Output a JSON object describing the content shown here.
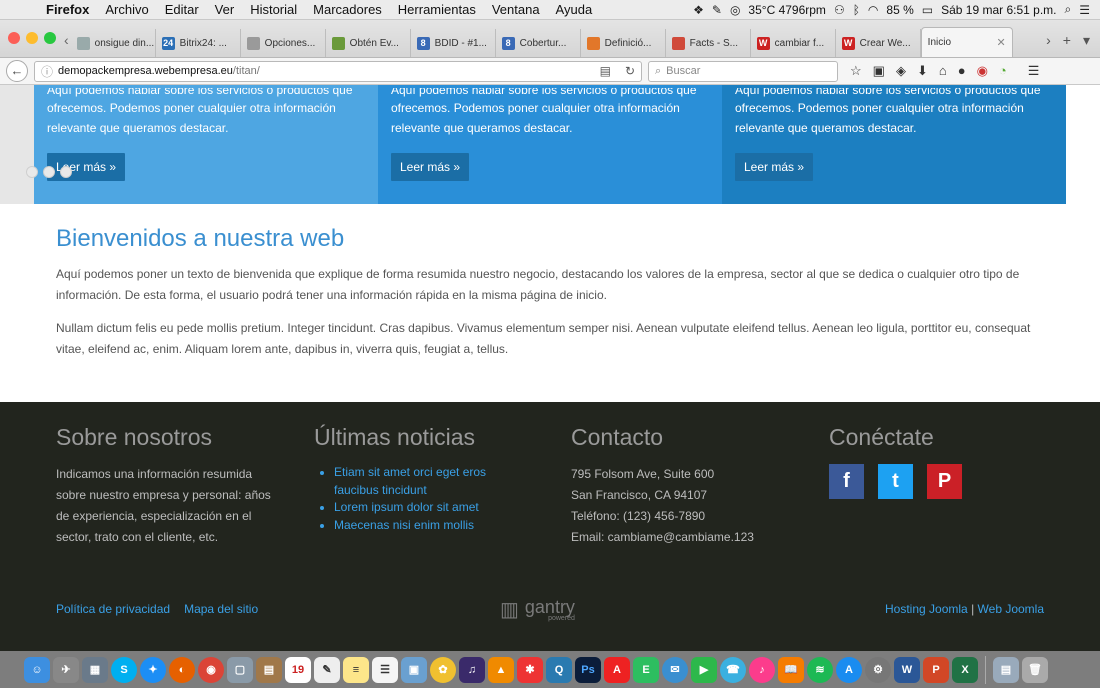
{
  "menubar": {
    "app": "Firefox",
    "items": [
      "Archivo",
      "Editar",
      "Ver",
      "Historial",
      "Marcadores",
      "Herramientas",
      "Ventana",
      "Ayuda"
    ],
    "temp": "35°C 4796rpm",
    "battery": "85 %",
    "clock": "Sáb 19 mar  6:51 p.m."
  },
  "tabs": [
    {
      "label": "onsigue din...",
      "color": "#9aa"
    },
    {
      "label": "Bitrix24: ...",
      "color": "#2b6fb6",
      "glyph": "24"
    },
    {
      "label": "Opciones...",
      "color": "#9a9a9a"
    },
    {
      "label": "Obtén Ev...",
      "color": "#6a9a3a"
    },
    {
      "label": "BDID - #1...",
      "color": "#3a6ab6",
      "glyph": "8"
    },
    {
      "label": "Cobertur...",
      "color": "#3a6ab6",
      "glyph": "8"
    },
    {
      "label": "Definició...",
      "color": "#e2772a"
    },
    {
      "label": "Facts - S...",
      "color": "#d04a3a"
    },
    {
      "label": "cambiar f...",
      "color": "#c22",
      "glyph": "W"
    },
    {
      "label": "Crear We...",
      "color": "#c22",
      "glyph": "W"
    },
    {
      "label": "Inicio",
      "active": true
    }
  ],
  "nav": {
    "url_host": "demopackempresa.webempresa.eu",
    "url_path": "/titan/",
    "search_placeholder": "Buscar"
  },
  "features": [
    {
      "top": "Aquí podemos hablar sobre los servicios o productos que",
      "body": "ofrecemos. Podemos poner cualquier otra información relevante que queramos destacar.",
      "button": "Leer más »"
    },
    {
      "top": "Aquí podemos hablar sobre los servicios o productos que",
      "body": "ofrecemos. Podemos poner cualquier otra información relevante que queramos destacar.",
      "button": "Leer más »"
    },
    {
      "top": "Aquí podemos hablar sobre los servicios o productos que",
      "body": "ofrecemos. Podemos poner cualquier otra información relevante que queramos destacar.",
      "button": "Leer más »"
    }
  ],
  "welcome": {
    "title": "Bienvenidos a nuestra web",
    "p1": "Aquí podemos poner un texto de bienvenida que explique de forma resumida nuestro negocio, destacando los valores de la empresa, sector al que se dedica o cualquier otro tipo de información. De esta forma, el usuario podrá tener una información rápida en la misma página de inicio.",
    "p2": "Nullam dictum felis eu pede mollis pretium. Integer tincidunt. Cras dapibus. Vivamus elementum semper nisi. Aenean vulputate eleifend tellus. Aenean leo ligula, porttitor eu, consequat vitae, eleifend ac, enim. Aliquam lorem ante, dapibus in, viverra quis, feugiat a, tellus."
  },
  "footer": {
    "about": {
      "title": "Sobre nosotros",
      "text": "Indicamos una información resumida sobre nuestro empresa y personal: años de experiencia, especialización en el sector, trato con el cliente, etc."
    },
    "news": {
      "title": "Últimas noticias",
      "items": [
        "Etiam sit amet orci eget eros faucibus tincidunt",
        "Lorem ipsum dolor sit amet",
        "Maecenas nisi enim mollis"
      ]
    },
    "contact": {
      "title": "Contacto",
      "address1": "795 Folsom Ave, Suite 600",
      "address2": "San Francisco, CA 94107",
      "phone": "Teléfono: (123) 456-7890",
      "email": "Email: cambiame@cambiame.123"
    },
    "connect": {
      "title": "Conéctate",
      "facebook_color": "#3b5998",
      "twitter_color": "#1da1f2",
      "pinterest_color": "#cb2027"
    },
    "links": {
      "privacy": "Política de privacidad",
      "sitemap": "Mapa del sitio"
    },
    "gantry": {
      "name": "gantry",
      "sub": "powered"
    },
    "right": {
      "hosting": "Hosting Joomla",
      "sep": "|",
      "web": "Web Joomla"
    }
  }
}
